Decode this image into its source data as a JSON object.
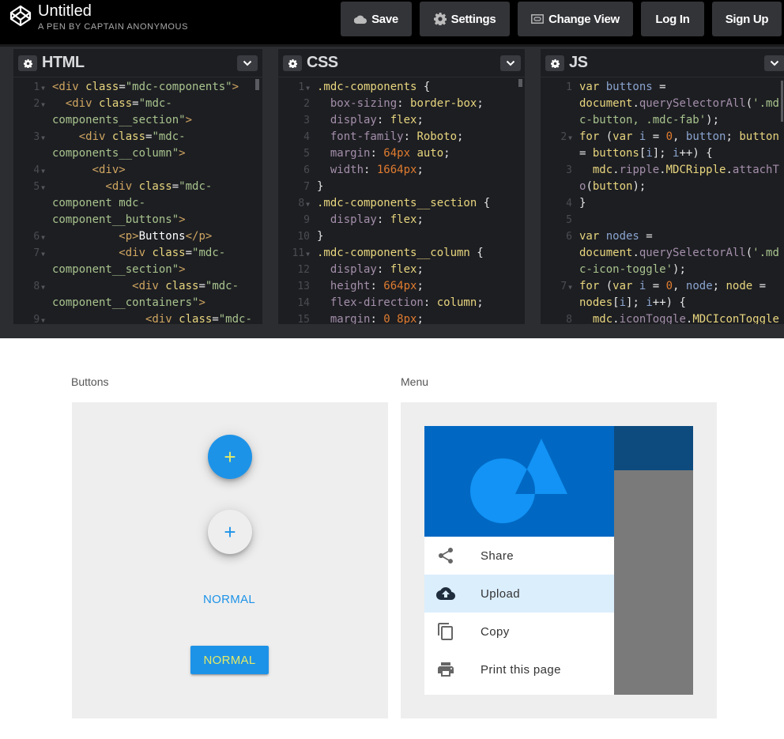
{
  "header": {
    "logo_icon": "codepen-logo-icon",
    "title": "Untitled",
    "subtitle": "A PEN BY CAPTAIN ANONYMOUS",
    "buttons": [
      {
        "label": "Save",
        "icon": "cloud-icon"
      },
      {
        "label": "Settings",
        "icon": "gear-icon"
      },
      {
        "label": "Change View",
        "icon": "change-view-icon"
      },
      {
        "label": "Log In"
      },
      {
        "label": "Sign Up"
      }
    ]
  },
  "editors": {
    "html": {
      "title": "HTML",
      "lines": [
        {
          "n": "1",
          "fold": true,
          "segs": [
            [
              "tag",
              "<div "
            ],
            [
              "attr",
              "class"
            ],
            [
              "punc",
              "="
            ],
            [
              "str",
              "\"mdc-components\""
            ],
            [
              "tag",
              ">"
            ]
          ]
        },
        {
          "n": "2",
          "fold": true,
          "segs": [
            [
              "tag",
              "  <div "
            ],
            [
              "attr",
              "class"
            ],
            [
              "punc",
              "="
            ],
            [
              "str",
              "\"mdc-"
            ]
          ]
        },
        {
          "n": "",
          "segs": [
            [
              "str",
              "components__section\""
            ],
            [
              "tag",
              ">"
            ]
          ]
        },
        {
          "n": "3",
          "fold": true,
          "segs": [
            [
              "tag",
              "    <div "
            ],
            [
              "attr",
              "class"
            ],
            [
              "punc",
              "="
            ],
            [
              "str",
              "\"mdc-"
            ]
          ]
        },
        {
          "n": "",
          "segs": [
            [
              "str",
              "components__column\""
            ],
            [
              "tag",
              ">"
            ]
          ]
        },
        {
          "n": "4",
          "fold": true,
          "segs": [
            [
              "tag",
              "      <div>"
            ]
          ]
        },
        {
          "n": "5",
          "fold": true,
          "segs": [
            [
              "tag",
              "        <div "
            ],
            [
              "attr",
              "class"
            ],
            [
              "punc",
              "="
            ],
            [
              "str",
              "\"mdc-"
            ]
          ]
        },
        {
          "n": "",
          "segs": [
            [
              "str",
              "component mdc-"
            ]
          ]
        },
        {
          "n": "",
          "segs": [
            [
              "str",
              "component__buttons\""
            ],
            [
              "tag",
              ">"
            ]
          ]
        },
        {
          "n": "6",
          "fold": true,
          "segs": [
            [
              "tag",
              "          <p>"
            ],
            [
              "txt",
              "Buttons"
            ],
            [
              "tag",
              "</p>"
            ]
          ]
        },
        {
          "n": "7",
          "fold": true,
          "segs": [
            [
              "tag",
              "          <div "
            ],
            [
              "attr",
              "class"
            ],
            [
              "punc",
              "="
            ],
            [
              "str",
              "\"mdc-"
            ]
          ]
        },
        {
          "n": "",
          "segs": [
            [
              "str",
              "component__section\""
            ],
            [
              "tag",
              ">"
            ]
          ]
        },
        {
          "n": "8",
          "fold": true,
          "segs": [
            [
              "tag",
              "            <div "
            ],
            [
              "attr",
              "class"
            ],
            [
              "punc",
              "="
            ],
            [
              "str",
              "\"mdc-"
            ]
          ]
        },
        {
          "n": "",
          "segs": [
            [
              "str",
              "component__containers\""
            ],
            [
              "tag",
              ">"
            ]
          ]
        },
        {
          "n": "9",
          "fold": true,
          "segs": [
            [
              "tag",
              "              <div "
            ],
            [
              "attr",
              "class"
            ],
            [
              "punc",
              "="
            ],
            [
              "str",
              "\"mdc-"
            ]
          ]
        }
      ]
    },
    "css": {
      "title": "CSS",
      "lines": [
        {
          "n": "1",
          "fold": true,
          "segs": [
            [
              "sel",
              ".mdc-components "
            ],
            [
              "punc",
              "{"
            ]
          ]
        },
        {
          "n": "2",
          "segs": [
            [
              "prop",
              "  box-sizing"
            ],
            [
              "punc",
              ": "
            ],
            [
              "val",
              "border-box"
            ],
            [
              "punc",
              ";"
            ]
          ]
        },
        {
          "n": "3",
          "segs": [
            [
              "prop",
              "  display"
            ],
            [
              "punc",
              ": "
            ],
            [
              "val",
              "flex"
            ],
            [
              "punc",
              ";"
            ]
          ]
        },
        {
          "n": "4",
          "segs": [
            [
              "prop",
              "  font-family"
            ],
            [
              "punc",
              ": "
            ],
            [
              "val",
              "Roboto"
            ],
            [
              "punc",
              ";"
            ]
          ]
        },
        {
          "n": "5",
          "segs": [
            [
              "prop",
              "  margin"
            ],
            [
              "punc",
              ": "
            ],
            [
              "num",
              "64px"
            ],
            [
              "val",
              " auto"
            ],
            [
              "punc",
              ";"
            ]
          ]
        },
        {
          "n": "6",
          "segs": [
            [
              "prop",
              "  width"
            ],
            [
              "punc",
              ": "
            ],
            [
              "num",
              "1664px"
            ],
            [
              "punc",
              ";"
            ]
          ]
        },
        {
          "n": "7",
          "segs": [
            [
              "punc",
              "}"
            ]
          ]
        },
        {
          "n": "8",
          "fold": true,
          "segs": [
            [
              "sel",
              ".mdc-components__section "
            ],
            [
              "punc",
              "{"
            ]
          ]
        },
        {
          "n": "9",
          "segs": [
            [
              "prop",
              "  display"
            ],
            [
              "punc",
              ": "
            ],
            [
              "val",
              "flex"
            ],
            [
              "punc",
              ";"
            ]
          ]
        },
        {
          "n": "10",
          "segs": [
            [
              "punc",
              "}"
            ]
          ]
        },
        {
          "n": "11",
          "fold": true,
          "segs": [
            [
              "sel",
              ".mdc-components__column "
            ],
            [
              "punc",
              "{"
            ]
          ]
        },
        {
          "n": "12",
          "segs": [
            [
              "prop",
              "  display"
            ],
            [
              "punc",
              ": "
            ],
            [
              "val",
              "flex"
            ],
            [
              "punc",
              ";"
            ]
          ]
        },
        {
          "n": "13",
          "segs": [
            [
              "prop",
              "  height"
            ],
            [
              "punc",
              ": "
            ],
            [
              "num",
              "664px"
            ],
            [
              "punc",
              ";"
            ]
          ]
        },
        {
          "n": "14",
          "segs": [
            [
              "prop",
              "  flex-direction"
            ],
            [
              "punc",
              ": "
            ],
            [
              "val",
              "column"
            ],
            [
              "punc",
              ";"
            ]
          ]
        },
        {
          "n": "15",
          "segs": [
            [
              "prop",
              "  margin"
            ],
            [
              "punc",
              ": "
            ],
            [
              "num",
              "0 8px"
            ],
            [
              "punc",
              ";"
            ]
          ]
        }
      ]
    },
    "js": {
      "title": "JS",
      "lines": [
        {
          "n": "1",
          "segs": [
            [
              "kw",
              "var "
            ],
            [
              "var",
              "buttons"
            ],
            [
              "punc",
              " ="
            ]
          ]
        },
        {
          "n": "",
          "segs": [
            [
              "kw",
              "document"
            ],
            [
              "punc",
              "."
            ],
            [
              "fn",
              "querySelectorAll"
            ],
            [
              "punc",
              "("
            ],
            [
              "str",
              "'.md"
            ]
          ]
        },
        {
          "n": "",
          "segs": [
            [
              "str",
              "c-button, .mdc-fab'"
            ],
            [
              "punc",
              ");"
            ]
          ]
        },
        {
          "n": "2",
          "fold": true,
          "segs": [
            [
              "kw",
              "for "
            ],
            [
              "punc",
              "("
            ],
            [
              "kw",
              "var "
            ],
            [
              "var",
              "i"
            ],
            [
              "punc",
              " = "
            ],
            [
              "num",
              "0"
            ],
            [
              "punc",
              ", "
            ],
            [
              "var",
              "button"
            ],
            [
              "punc",
              "; "
            ],
            [
              "kw",
              "button"
            ]
          ]
        },
        {
          "n": "",
          "segs": [
            [
              "punc",
              "= "
            ],
            [
              "kw",
              "buttons"
            ],
            [
              "punc",
              "["
            ],
            [
              "var",
              "i"
            ],
            [
              "punc",
              "]; "
            ],
            [
              "var",
              "i"
            ],
            [
              "punc",
              "++) {"
            ]
          ]
        },
        {
          "n": "3",
          "segs": [
            [
              "kw",
              "  mdc"
            ],
            [
              "punc",
              "."
            ],
            [
              "fn",
              "ripple"
            ],
            [
              "punc",
              "."
            ],
            [
              "kw",
              "MDCRipple"
            ],
            [
              "punc",
              "."
            ],
            [
              "fn",
              "attachT"
            ]
          ]
        },
        {
          "n": "",
          "segs": [
            [
              "fn",
              "o"
            ],
            [
              "punc",
              "("
            ],
            [
              "kw",
              "button"
            ],
            [
              "punc",
              ");"
            ]
          ]
        },
        {
          "n": "4",
          "segs": [
            [
              "punc",
              "}"
            ]
          ]
        },
        {
          "n": "5",
          "segs": []
        },
        {
          "n": "6",
          "segs": [
            [
              "kw",
              "var "
            ],
            [
              "var",
              "nodes"
            ],
            [
              "punc",
              " ="
            ]
          ]
        },
        {
          "n": "",
          "segs": [
            [
              "kw",
              "document"
            ],
            [
              "punc",
              "."
            ],
            [
              "fn",
              "querySelectorAll"
            ],
            [
              "punc",
              "("
            ],
            [
              "str",
              "'.md"
            ]
          ]
        },
        {
          "n": "",
          "segs": [
            [
              "str",
              "c-icon-toggle'"
            ],
            [
              "punc",
              ");"
            ]
          ]
        },
        {
          "n": "7",
          "fold": true,
          "segs": [
            [
              "kw",
              "for "
            ],
            [
              "punc",
              "("
            ],
            [
              "kw",
              "var "
            ],
            [
              "var",
              "i"
            ],
            [
              "punc",
              " = "
            ],
            [
              "num",
              "0"
            ],
            [
              "punc",
              ", "
            ],
            [
              "var",
              "node"
            ],
            [
              "punc",
              "; "
            ],
            [
              "kw",
              "node"
            ],
            [
              "punc",
              " ="
            ]
          ]
        },
        {
          "n": "",
          "segs": [
            [
              "kw",
              "nodes"
            ],
            [
              "punc",
              "["
            ],
            [
              "var",
              "i"
            ],
            [
              "punc",
              "]; "
            ],
            [
              "var",
              "i"
            ],
            [
              "punc",
              "++) {"
            ]
          ]
        },
        {
          "n": "8",
          "segs": [
            [
              "kw",
              "  mdc"
            ],
            [
              "punc",
              "."
            ],
            [
              "fn",
              "iconToggle"
            ],
            [
              "punc",
              "."
            ],
            [
              "kw",
              "MDCIconToggle"
            ]
          ]
        }
      ]
    }
  },
  "preview": {
    "buttons_section": {
      "label": "Buttons",
      "fab_primary": "+",
      "fab_mini": "+",
      "flat_button": "NORMAL",
      "raised_button": "NORMAL"
    },
    "menu_section": {
      "label": "Menu",
      "items": [
        {
          "label": "Share",
          "icon": "share-icon",
          "active": false
        },
        {
          "label": "Upload",
          "icon": "upload-icon",
          "active": true
        },
        {
          "label": "Copy",
          "icon": "copy-icon",
          "active": false
        },
        {
          "label": "Print this page",
          "icon": "print-icon",
          "active": false
        }
      ]
    }
  },
  "colors": {
    "accent_blue": "#1d93e8",
    "accent_yellow": "#e4ea66",
    "menu_hero": "#0068c3",
    "menu_highlight": "#dbeefc"
  }
}
